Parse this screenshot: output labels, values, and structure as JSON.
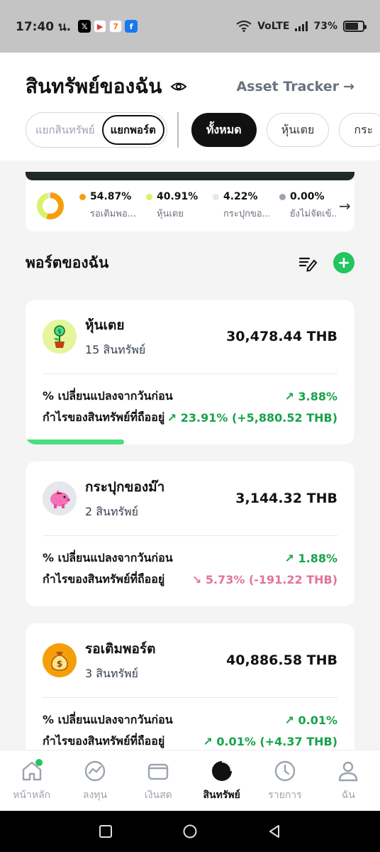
{
  "status_bar": {
    "time": "17:40 น.",
    "apps": [
      {
        "icon": "x-app-icon",
        "glyph": "𝕏",
        "color": "#000000"
      },
      {
        "icon": "youtube-app-icon",
        "glyph": "▶",
        "color": "#e53935"
      },
      {
        "icon": "seven-eleven-app-icon",
        "glyph": "7",
        "color": "#f57c00"
      },
      {
        "icon": "facebook-app-icon",
        "glyph": "f",
        "color": "#1877f2"
      }
    ],
    "network": "VoLTE",
    "battery": "73%",
    "battery_level": 0.73
  },
  "header": {
    "title": "สินทรัพย์ของฉัน",
    "tracker_link": "Asset Tracker",
    "segments": [
      "แยกสินทรัพย์",
      "แยกพอร์ต"
    ],
    "active_segment": 1,
    "filters": [
      "ทั้งหมด",
      "หุ้นเตย",
      "กระ"
    ],
    "active_filter": 0
  },
  "allocation": {
    "items": [
      {
        "pct": "54.87%",
        "name": "รอเติมพอ...",
        "color": "#f59e0b",
        "value": 54.87
      },
      {
        "pct": "40.91%",
        "name": "หุ้นเตย",
        "color": "#d9f26b",
        "value": 40.91
      },
      {
        "pct": "4.22%",
        "name": "กระปุกขอ...",
        "color": "#e5e7eb",
        "value": 4.22
      },
      {
        "pct": "0.00%",
        "name": "ยังไม่จัดเข้...",
        "color": "#9ca3af",
        "value": 0
      }
    ]
  },
  "portfolio_section": {
    "title": "พอร์ตของฉัน"
  },
  "portfolios": [
    {
      "name": "หุ้นเตย",
      "count": "15 สินทรัพย์",
      "value": "30,478.44 THB",
      "change_label": "% เปลี่ยนแปลงจากวันก่อน",
      "change": "3.88%",
      "change_dir": "up",
      "profit_label": "กำไรของสินทรัพย์ที่ถืออยู่",
      "profit": "23.91% (+5,880.52 THB)",
      "profit_dir": "up",
      "icon": "plant-coin-icon",
      "icon_bg": "#e4f59a",
      "progress": 0.3
    },
    {
      "name": "กระปุกของม๊า",
      "count": "2 สินทรัพย์",
      "value": "3,144.32 THB",
      "change_label": "% เปลี่ยนแปลงจากวันก่อน",
      "change": "1.88%",
      "change_dir": "up",
      "profit_label": "กำไรของสินทรัพย์ที่ถืออยู่",
      "profit": "5.73% (-191.22 THB)",
      "profit_dir": "down",
      "icon": "piggy-bank-icon",
      "icon_bg": "#e5e7eb"
    },
    {
      "name": "รอเติมพอร์ต",
      "count": "3 สินทรัพย์",
      "value": "40,886.58 THB",
      "change_label": "% เปลี่ยนแปลงจากวันก่อน",
      "change": "0.01%",
      "change_dir": "up",
      "profit_label": "กำไรของสินทรัพย์ที่ถืออยู่",
      "profit": "0.01% (+4.37 THB)",
      "profit_dir": "up",
      "icon": "money-bag-icon",
      "icon_bg": "#f59e0b"
    }
  ],
  "bottom_nav": [
    {
      "label": "หน้าหลัก",
      "icon": "home-icon"
    },
    {
      "label": "ลงทุน",
      "icon": "invest-icon"
    },
    {
      "label": "เงินสด",
      "icon": "wallet-icon"
    },
    {
      "label": "สินทรัพย์",
      "icon": "pie-chart-icon"
    },
    {
      "label": "รายการ",
      "icon": "history-icon"
    },
    {
      "label": "ฉัน",
      "icon": "profile-icon"
    }
  ],
  "active_nav": 3
}
